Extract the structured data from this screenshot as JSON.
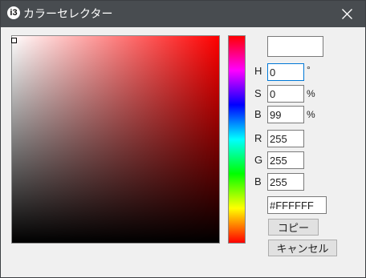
{
  "window": {
    "title": "カラーセレクター",
    "app_icon_glyph": "i3",
    "close_glyph": "close-icon"
  },
  "picker": {
    "hue_degrees": 0,
    "saturation_percent": 0,
    "brightness_percent": 99,
    "selected_color": "#FFFFFF",
    "plane_hue_color": "#FF0000"
  },
  "labels": {
    "h": "H",
    "s": "S",
    "b": "B",
    "r": "R",
    "g": "G",
    "b2": "B",
    "degree_unit": "°",
    "s_unit": "%",
    "b_unit": "%"
  },
  "fields": {
    "h": "0",
    "s": "0",
    "b": "99",
    "r": "255",
    "g": "255",
    "b2": "255",
    "hex": "#FFFFFF"
  },
  "buttons": {
    "copy": "コピー",
    "cancel": "キャンセル"
  }
}
